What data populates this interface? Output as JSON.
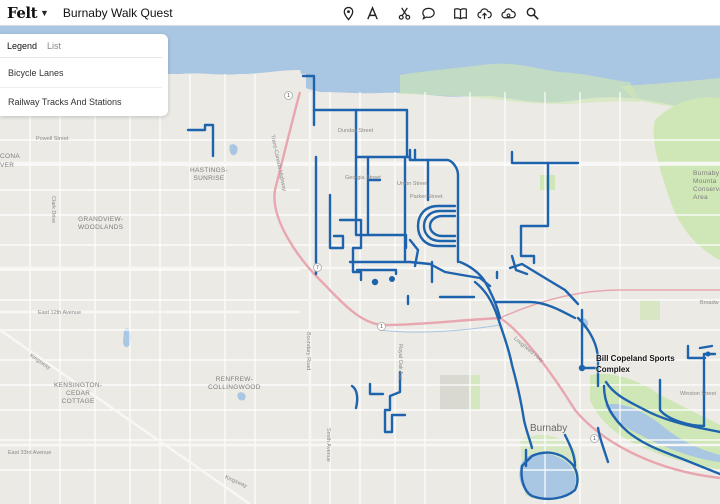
{
  "app": {
    "logo": "Felt",
    "title": "Burnaby Walk Quest"
  },
  "toolbar": {
    "tools": [
      "pin-icon",
      "text-tool-icon",
      "scissors-icon",
      "comment-icon",
      "book-icon",
      "upload-cloud-icon",
      "cloud-data-icon",
      "search-icon"
    ]
  },
  "legend": {
    "tabs": [
      "Legend",
      "List"
    ],
    "active_tab": "Legend",
    "layers": [
      "Bicycle Lanes",
      "Railway Tracks And Stations"
    ]
  },
  "map": {
    "route_color": "#1e63ad",
    "water_color": "#a9c6e2",
    "park_color": "#cfe6b6",
    "labels": {
      "cona": "CONA",
      "ver": "VER",
      "hastings_sunrise": "HASTINGS-\nSUNRISE",
      "grandview": "GRANDVIEW-\nWOODLANDS",
      "renfrew": "RENFREW-\nCOLLINGWOOD",
      "kensington": "KENSINGTON-\nCEDAR\nCOTTAGE",
      "burnaby_mountain": "Burnaby\nMounta\nConserva\nArea",
      "burnaby": "Burnaby",
      "poi": "Bill Copeland Sports\nComplex"
    },
    "roads": {
      "powell": "Powell Street",
      "dundas": "Dundas Street",
      "georgia": "Georgia Street",
      "union": "Union Street",
      "parker": "Parker Street",
      "east12": "East 12th Avenue",
      "east33": "East 33rd Avenue",
      "kingsway": "Kingsway",
      "kingsway2": "Kingsway",
      "clark": "Clark Drive",
      "transcanada": "Trans-Canada Highway",
      "boundary": "Boundary Road",
      "smith": "Smith Avenue",
      "royal": "Royal Oak Ave",
      "winston": "Winston Street",
      "broadway": "Broadw",
      "lougheed": "Lougheed Hwy"
    },
    "shields": [
      "1",
      "7",
      "1",
      "1"
    ]
  }
}
